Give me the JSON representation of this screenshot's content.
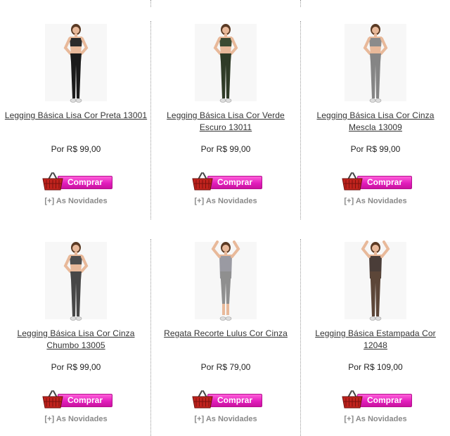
{
  "products": [
    {
      "name": "Legging Básica Lisa Cor Preta 13001",
      "price": "Por R$ 99,00",
      "buy_label": "Comprar",
      "more_label": "[+] As Novidades",
      "top_color": "#2a2a2a",
      "bottom_color": "#1b1b1b",
      "pose": "hands-hips"
    },
    {
      "name": "Legging Básica Lisa Cor Verde Escuro 13011",
      "price": "Por R$ 99,00",
      "buy_label": "Comprar",
      "more_label": "[+] As Novidades",
      "top_color": "#3b4a32",
      "bottom_color": "#2f3b27",
      "pose": "hands-hips"
    },
    {
      "name": "Legging Básica Lisa Cor Cinza Mescla 13009",
      "price": "Por R$ 99,00",
      "buy_label": "Comprar",
      "more_label": "[+] As Novidades",
      "top_color": "#8b8b8b",
      "bottom_color": "#858585",
      "pose": "hands-hips"
    },
    {
      "name": "Legging Básica Lisa Cor Cinza Chumbo 13005",
      "price": "Por R$ 99,00",
      "buy_label": "Comprar",
      "more_label": "[+] As Novidades",
      "top_color": "#4d4d4d",
      "bottom_color": "#474747",
      "pose": "hands-hips"
    },
    {
      "name": "Regata Recorte Lulus Cor Cinza",
      "price": "Por R$ 79,00",
      "buy_label": "Comprar",
      "more_label": "[+] As Novidades",
      "top_color": "#9a9aa2",
      "bottom_color": "#8f8f8f",
      "pose": "arms-up"
    },
    {
      "name": "Legging Básica Estampada Cor 12048",
      "price": "Por R$ 109,00",
      "buy_label": "Comprar",
      "more_label": "[+] As Novidades",
      "top_color": "#4a3d38",
      "bottom_color": "#5c4638",
      "pose": "arms-up"
    }
  ],
  "colors": {
    "button_pink": "#e21fbd",
    "basket_red": "#c0231d"
  }
}
